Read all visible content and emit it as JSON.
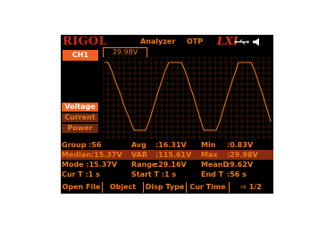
{
  "header": {
    "logo": "RIGOL",
    "mode": "Analyzer",
    "otp": "OTP",
    "lxi": "LXI"
  },
  "channel": "CH1",
  "readout": "29.98V",
  "side_menu": {
    "items": [
      "Voltage",
      "Current",
      "Power"
    ]
  },
  "stats": {
    "row1": {
      "group": "Group :56",
      "avg": "Avg",
      "avg_val": ":16.31V",
      "min": "Min",
      "min_val": ":0.83V"
    },
    "row2": {
      "median": "Median:15.37V",
      "var": "VAR",
      "var_val": ":115.61V",
      "max": "Max",
      "max_val": ":29.98V"
    },
    "row3": {
      "mode": "Mode :15.37V",
      "range": "Range",
      "range_val": ":29.16V",
      "meand": "MeanD",
      "meand_val": ":9.62V"
    },
    "row4": {
      "cur_t": "Cur T :1 s",
      "start_t": "Start T :1 s",
      "end_t": "End T",
      "end_t_val": ":56 s"
    }
  },
  "softkeys": [
    "Open File",
    "Object",
    "Disp Type",
    "Cur Time",
    "1/2"
  ],
  "colors": {
    "accent": "#f07a18",
    "logo": "#d12a14",
    "highlight": "#8a2d0e",
    "active_btn": "#f2601b"
  }
}
